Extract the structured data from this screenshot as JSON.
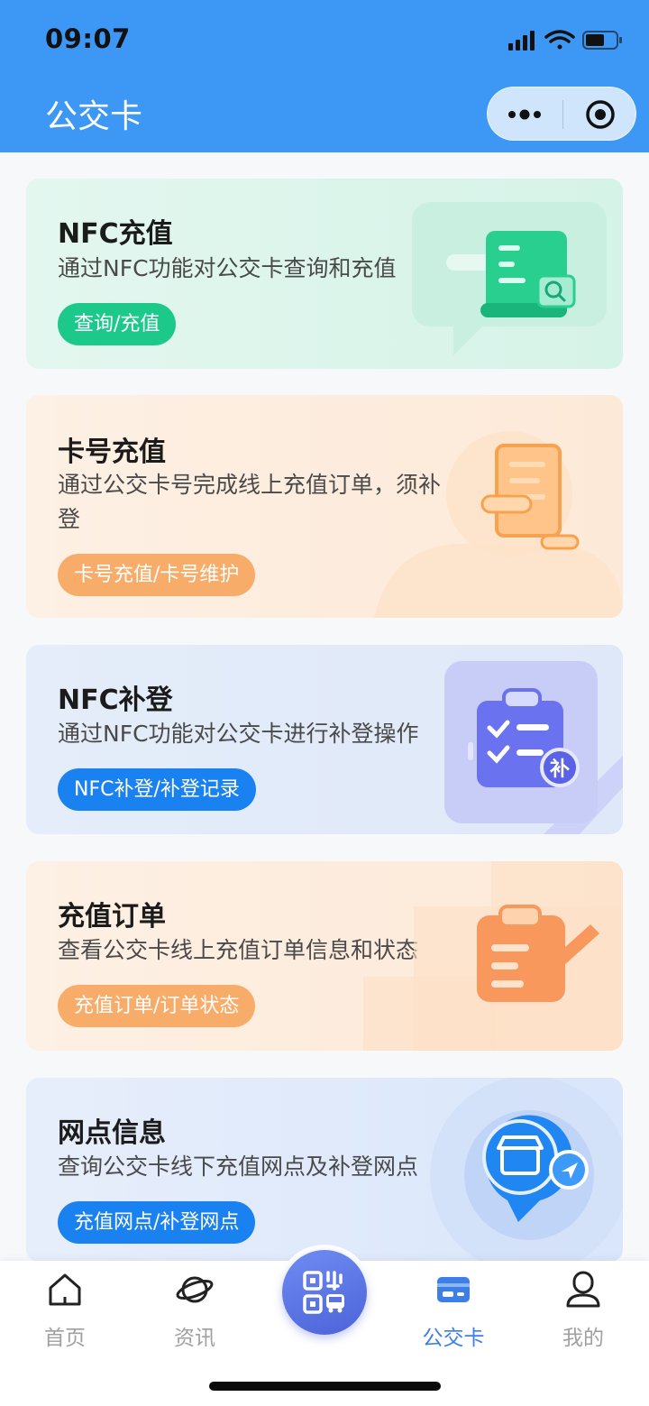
{
  "status_bar": {
    "time": "09:07"
  },
  "header": {
    "title": "公交卡"
  },
  "cards": [
    {
      "title": "NFC充值",
      "desc": "通过NFC功能对公交卡查询和充值",
      "button": "查询/充值",
      "icon": "receipt-search-icon",
      "bg": "#dff5ec",
      "btn_color": "#1cc98b"
    },
    {
      "title": "卡号充值",
      "desc": "通过公交卡号完成线上充值订单，须补登",
      "button": "卡号充值/卡号维护",
      "icon": "phone-card-icon",
      "bg": "#fdeee0",
      "btn_color": "#f8ac6a"
    },
    {
      "title": "NFC补登",
      "desc": "通过NFC功能对公交卡进行补登操作",
      "button": "NFC补登/补登记录",
      "icon": "clipboard-checklist-icon",
      "badge": "补",
      "bg": "#e3ecf9",
      "btn_color": "#1a82f0"
    },
    {
      "title": "充值订单",
      "desc": "查看公交卡线上充值订单信息和状态",
      "button": "充值订单/订单状态",
      "icon": "clipboard-pen-icon",
      "bg": "#fdeee0",
      "btn_color": "#f8ac6a"
    },
    {
      "title": "网点信息",
      "desc": "查询公交卡线下充值网点及补登网点",
      "button": "充值网点/补登网点",
      "icon": "store-location-icon",
      "bg": "#e3ecf9",
      "btn_color": "#1a82f0"
    }
  ],
  "tabbar": {
    "items": [
      {
        "label": "首页",
        "icon": "home-icon"
      },
      {
        "label": "资讯",
        "icon": "planet-icon"
      },
      {
        "label": "",
        "icon": "qr-bus-icon"
      },
      {
        "label": "公交卡",
        "icon": "bus-card-icon",
        "active": true
      },
      {
        "label": "我的",
        "icon": "person-icon"
      }
    ]
  }
}
